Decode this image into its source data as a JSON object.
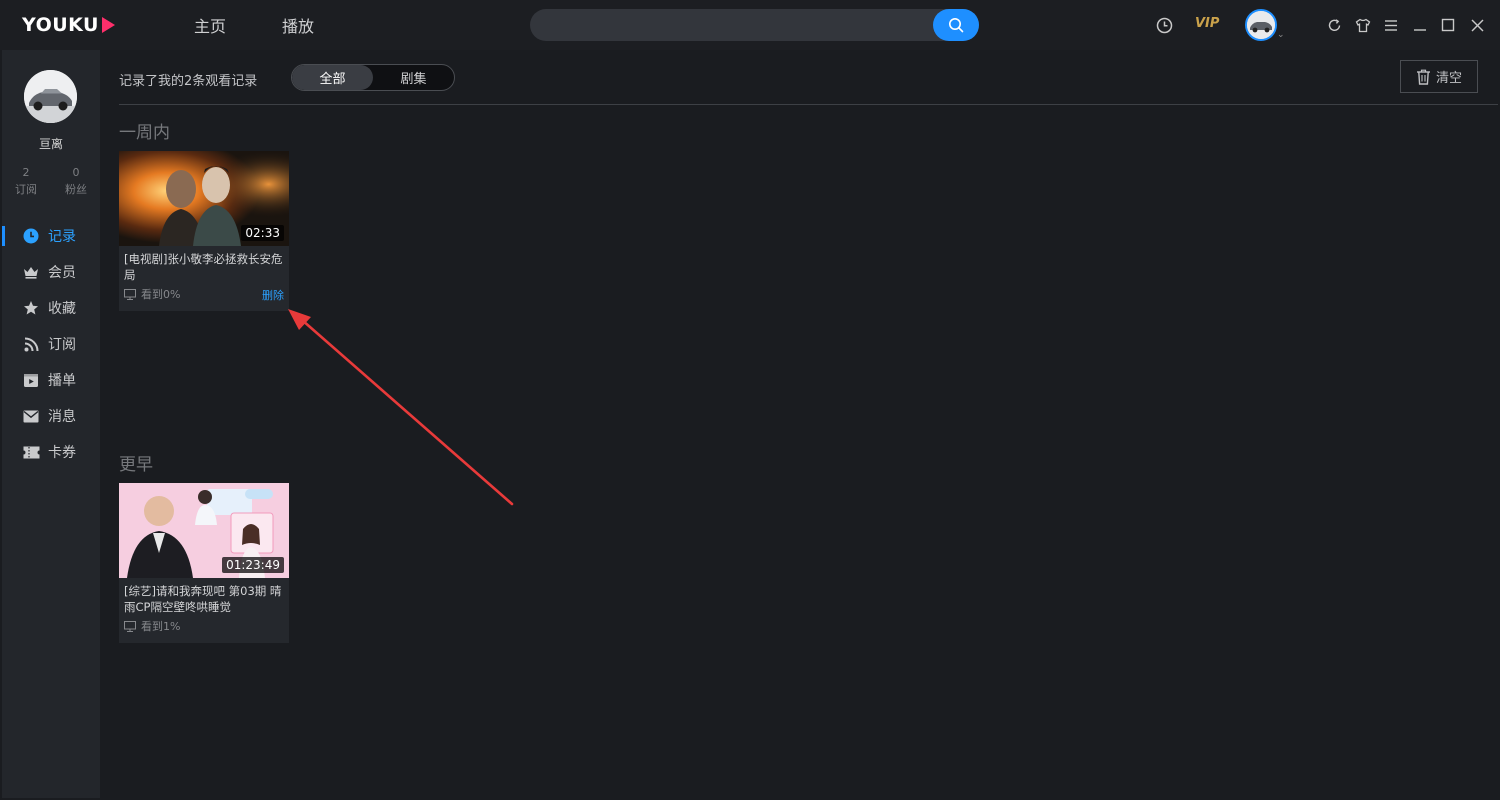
{
  "app": {
    "logo_text": "YOUKU",
    "nav": {
      "home": "主页",
      "play": "播放"
    },
    "search": {
      "placeholder": ""
    },
    "vip_label": "VIP",
    "accent_color": "#1e8fff",
    "logo_accent_color": "#ff2f6b"
  },
  "sidebar": {
    "username": "亘离",
    "stats": [
      {
        "value": "2",
        "label": "订阅"
      },
      {
        "value": "0",
        "label": "粉丝"
      }
    ],
    "menu": [
      {
        "label": "记录",
        "icon": "clock-icon",
        "active": true
      },
      {
        "label": "会员",
        "icon": "crown-icon",
        "active": false
      },
      {
        "label": "收藏",
        "icon": "star-icon",
        "active": false
      },
      {
        "label": "订阅",
        "icon": "rss-icon",
        "active": false
      },
      {
        "label": "播单",
        "icon": "playlist-icon",
        "active": false
      },
      {
        "label": "消息",
        "icon": "mail-icon",
        "active": false
      },
      {
        "label": "卡券",
        "icon": "ticket-icon",
        "active": false
      }
    ]
  },
  "main": {
    "record_count_text": "记录了我的2条观看记录",
    "filters": [
      "全部",
      "剧集"
    ],
    "active_filter": "全部",
    "clear_label": "清空",
    "sections": [
      {
        "title": "一周内",
        "items": [
          {
            "title": "[电视剧]张小敬李必拯救长安危局",
            "duration": "02:33",
            "progress": "看到0%",
            "delete_label": "删除"
          }
        ]
      },
      {
        "title": "更早",
        "items": [
          {
            "title": "[综艺]请和我奔现吧 第03期 晴雨CP隔空壁咚哄睡觉",
            "duration": "01:23:49",
            "progress": "看到1%"
          }
        ]
      }
    ]
  },
  "annotation": {
    "arrow_color": "#e83a3a"
  }
}
